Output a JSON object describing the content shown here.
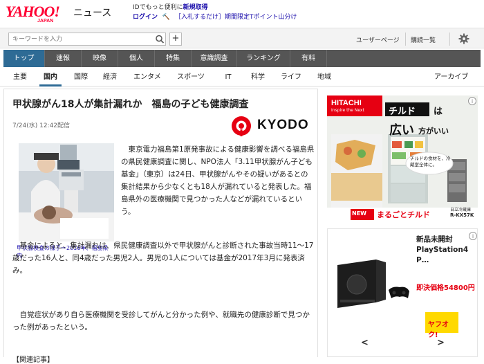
{
  "header": {
    "logo_text": "YAHOO!",
    "logo_sub": "JAPAN",
    "section": "ニュース",
    "promo_line1_prefix": "IDでもっと便利に",
    "promo_line1_emph": "新規取得",
    "promo_login": "ログイン",
    "promo_link": "［入札するだけ］期間限定Tポイント山分け"
  },
  "search": {
    "placeholder": "キーワードを入力",
    "add_label": "+",
    "user_page": "ユーザーページ",
    "history": "購読一覧"
  },
  "main_nav": [
    {
      "label": "トップ",
      "active": true
    },
    {
      "label": "速報"
    },
    {
      "label": "映像"
    },
    {
      "label": "個人"
    },
    {
      "label": "特集"
    },
    {
      "label": "意識調査"
    },
    {
      "label": "ランキング"
    },
    {
      "label": "有料"
    }
  ],
  "sub_nav": [
    {
      "label": "主要"
    },
    {
      "label": "国内",
      "active": true
    },
    {
      "label": "国際"
    },
    {
      "label": "経済"
    },
    {
      "label": "エンタメ"
    },
    {
      "label": "スポーツ"
    },
    {
      "label": "IT"
    },
    {
      "label": "科学"
    },
    {
      "label": "ライフ"
    },
    {
      "label": "地域"
    }
  ],
  "archive": "アーカイブ",
  "article": {
    "headline": "甲状腺がん18人が集計漏れか　福島の子ども健康調査",
    "date": "7/24(水) 12:42配信",
    "source": "KYODO",
    "caption": "甲状腺検査の様子＝2016年、福島県内",
    "p1": "東京電力福島第1原発事故による健康影響を調べる福島県の県民健康調査に関し、NPO法人「3.11甲状腺がん子ども基金」（東京）は24日、甲状腺がんやその疑いがあるとの集計結果から少なくとも18人が漏れていると発表した。福島県外の医療機関で見つかった人などが漏れているという。",
    "p2": "基金によると、集計漏れは、県民健康調査以外で甲状腺がんと診断された事故当時11～17歳だった16人と、同4歳だった男児2人。男児の1人については基金が2017年3月に発表済み。",
    "p3": "自覚症状があり自ら医療機関を受診してがんと分かった例や、就職先の健康診断で見つかった例があったという。",
    "related": "【関連記事】"
  },
  "ad1": {
    "brand": "HITACHI",
    "brand_sub": "Inspire the Next",
    "chilled": "チルド",
    "ha": "は",
    "wide": "広い",
    "wide_suffix": "方がいい",
    "bubble": "チルドの食材を、冷蔵室全体に。",
    "new_badge": "NEW",
    "tagline": "まるごとチルド",
    "model_line1": "日立冷蔵庫",
    "model_line2": "R-KX57K"
  },
  "ad2": {
    "title": "新品未開封 PlayStation4 P…",
    "price": "即決価格54800円",
    "auction_logo": "ヤフオク!",
    "prev": "<",
    "next": ">"
  },
  "colors": {
    "nav_bg": "#555555",
    "nav_active": "#2e6b95",
    "link": "#1a0dab",
    "yahoo_red": "#ff0033",
    "price_red": "#e60012"
  }
}
